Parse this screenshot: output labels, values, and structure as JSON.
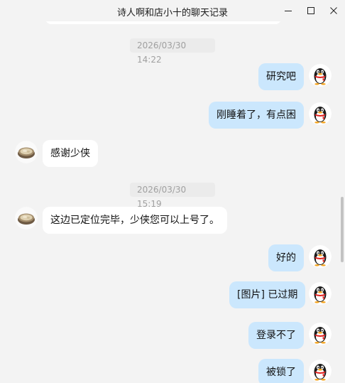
{
  "window": {
    "title": "诗人啊和店小十的聊天记录"
  },
  "messages": [
    {
      "type": "timestamp",
      "text": "2026/03/30 14:22"
    },
    {
      "type": "message",
      "side": "right",
      "text": "研究吧",
      "avatar": "qq-penguin-icon"
    },
    {
      "type": "message",
      "side": "right",
      "text": "刚睡着了，有点困",
      "avatar": "qq-penguin-icon"
    },
    {
      "type": "message",
      "side": "left",
      "text": "感谢少侠",
      "avatar": "food-bowl-avatar-icon"
    },
    {
      "type": "timestamp",
      "text": "2026/03/30 15:19"
    },
    {
      "type": "message",
      "side": "left",
      "text": "这边已定位完毕，少侠您可以上号了。",
      "avatar": "food-bowl-avatar-icon"
    },
    {
      "type": "message",
      "side": "right",
      "text": "好的",
      "avatar": "qq-penguin-icon"
    },
    {
      "type": "message",
      "side": "right",
      "text": "[图片] 已过期",
      "avatar": "qq-penguin-icon"
    },
    {
      "type": "message",
      "side": "right",
      "text": "登录不了",
      "avatar": "qq-penguin-icon"
    },
    {
      "type": "message",
      "side": "right",
      "text": "被锁了",
      "avatar": "qq-penguin-icon"
    }
  ],
  "colors": {
    "background": "#f3f3f3",
    "self_bubble": "#cbe7fd",
    "other_bubble": "#ffffff",
    "timestamp_text": "#a0a0a0"
  }
}
